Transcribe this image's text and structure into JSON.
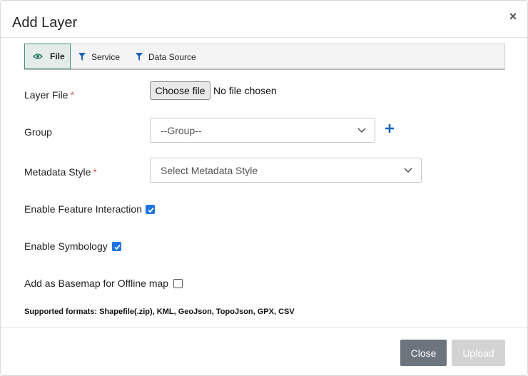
{
  "dialog": {
    "title": "Add Layer",
    "close_glyph": "×"
  },
  "tabs": [
    {
      "label": "File",
      "icon": "eye-icon",
      "active": true
    },
    {
      "label": "Service",
      "icon": "filter-icon",
      "active": false
    },
    {
      "label": "Data Source",
      "icon": "filter-icon",
      "active": false
    }
  ],
  "form": {
    "layer_file": {
      "label": "Layer File",
      "required_mark": "*",
      "button_label": "Choose file",
      "status": "No file chosen"
    },
    "group": {
      "label": "Group",
      "selected": "--Group--"
    },
    "metadata_style": {
      "label": "Metadata Style",
      "required_mark": "*",
      "selected": "Select Metadata Style"
    },
    "enable_feature_interaction": {
      "label": "Enable Feature Interaction",
      "checked": true
    },
    "enable_symbology": {
      "label": "Enable Symbology",
      "checked": true
    },
    "basemap_offline": {
      "label": "Add as Basemap for Offline map",
      "checked": false
    }
  },
  "supported_formats": "Supported formats: Shapefile(.zip), KML, GeoJson, TopoJson, GPX, CSV",
  "footer": {
    "close_label": "Close",
    "upload_label": "Upload"
  },
  "colors": {
    "accent": "#3f8f7a",
    "checkbox": "#1a73e8",
    "plus": "#1565c0",
    "close_button": "#6c757d",
    "upload_disabled": "#d3d3d3",
    "required": "#d9534f"
  }
}
